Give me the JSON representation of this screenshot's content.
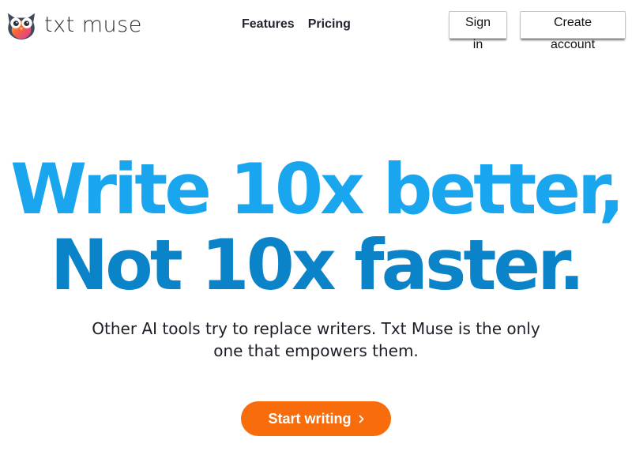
{
  "brand": {
    "name": "txt muse",
    "logo_icon": "owl-icon"
  },
  "nav": {
    "items": [
      {
        "label": "Features"
      },
      {
        "label": "Pricing"
      }
    ]
  },
  "auth": {
    "sign_in_label": "Sign in",
    "create_account_label": "Create account"
  },
  "hero": {
    "line1": "Write 10x better,",
    "line2": "Not 10x faster.",
    "subtitle": "Other AI tools try to replace writers. Txt Muse is the only one that empowers them.",
    "cta_label": "Start writing",
    "cta_icon": "chevron-right-icon"
  },
  "colors": {
    "headline_light_blue": "#1aa6ee",
    "headline_dark_blue": "#0a83c9",
    "cta_orange": "#f96c0c",
    "text_dark": "#1b1e26"
  }
}
